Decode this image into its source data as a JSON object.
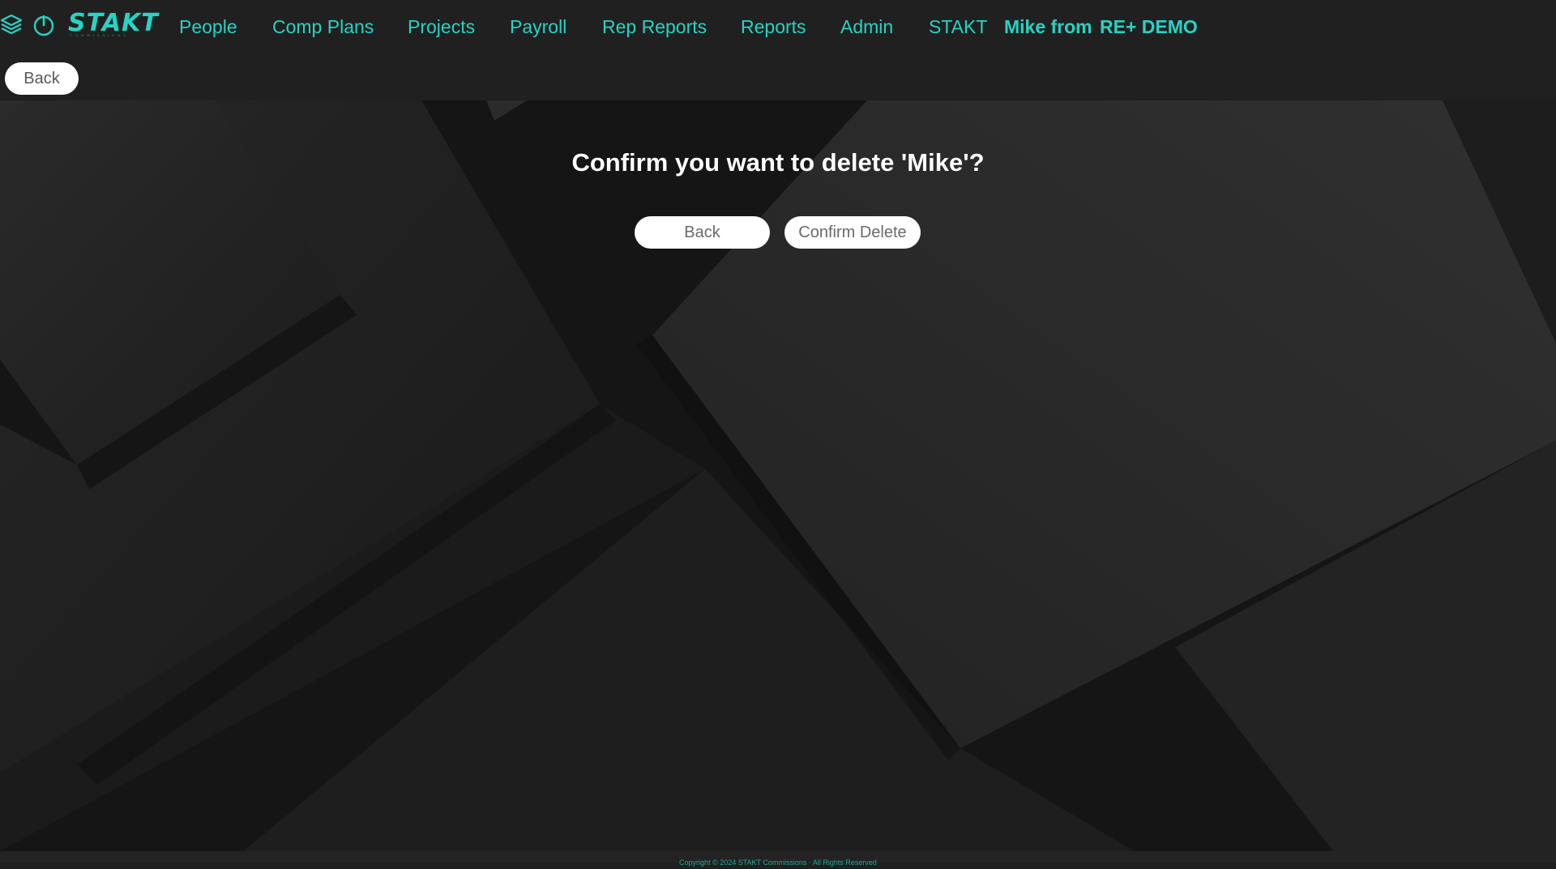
{
  "nav": {
    "brand": "STAKT",
    "brand_sub": "COMMISSIONS",
    "items": [
      {
        "label": "People"
      },
      {
        "label": "Comp Plans"
      },
      {
        "label": "Projects"
      },
      {
        "label": "Payroll"
      },
      {
        "label": "Rep Reports"
      },
      {
        "label": "Reports"
      },
      {
        "label": "Admin"
      },
      {
        "label": "STAKT"
      }
    ],
    "user": "Mike from",
    "org": "RE+ DEMO"
  },
  "toolbar": {
    "back_label": "Back"
  },
  "dialog": {
    "title": "Confirm you want to delete 'Mike'?",
    "back_label": "Back",
    "confirm_label": "Confirm Delete"
  },
  "footer": {
    "text": "Copyright © 2024 STAKT Commissions · All Rights Reserved"
  },
  "colors": {
    "accent": "#27d3c4",
    "background": "#1f1f1f",
    "button": "#ffffff"
  },
  "icons": [
    "layers-icon",
    "power-icon"
  ]
}
